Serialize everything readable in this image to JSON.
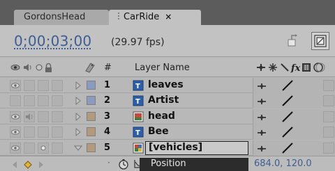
{
  "tabs": [
    {
      "label": "GordonsHead",
      "active": false
    },
    {
      "label": "CarRide",
      "active": true,
      "close": "×"
    }
  ],
  "header": {
    "timecode": "0;00;03;00",
    "fps": "(29.97 fps)"
  },
  "columns": {
    "number": "#",
    "layer_name": "Layer Name"
  },
  "layers": [
    {
      "number": "1",
      "name": "leaves",
      "icon": "text-layer-icon",
      "label_color": "#8a9ac0",
      "eye": true,
      "audio": false,
      "twirl": "closed"
    },
    {
      "number": "2",
      "name": "Artist",
      "icon": "text-layer-icon",
      "label_color": "#8a9ac0",
      "eye": false,
      "audio": false,
      "twirl": "closed"
    },
    {
      "number": "3",
      "name": "head",
      "icon": "footage-layer-icon",
      "label_color": "#b39a7c",
      "eye": true,
      "audio": true,
      "twirl": "closed"
    },
    {
      "number": "4",
      "name": "Bee",
      "icon": "text-layer-icon",
      "label_color": "#b39a7c",
      "eye": true,
      "audio": false,
      "twirl": "closed"
    },
    {
      "number": "5",
      "name": "[vehicles]",
      "icon": "precomp-layer-icon",
      "label_color": "#b39a7c",
      "eye": true,
      "audio": false,
      "solo": true,
      "twirl": "open",
      "selected": true
    }
  ],
  "property": {
    "name": "Position",
    "value": "684.0, 120.0"
  },
  "colors": {
    "accent_blue": "#3d5d95",
    "panel": "#b9b9b9",
    "tabbar": "#5c5c5c"
  }
}
